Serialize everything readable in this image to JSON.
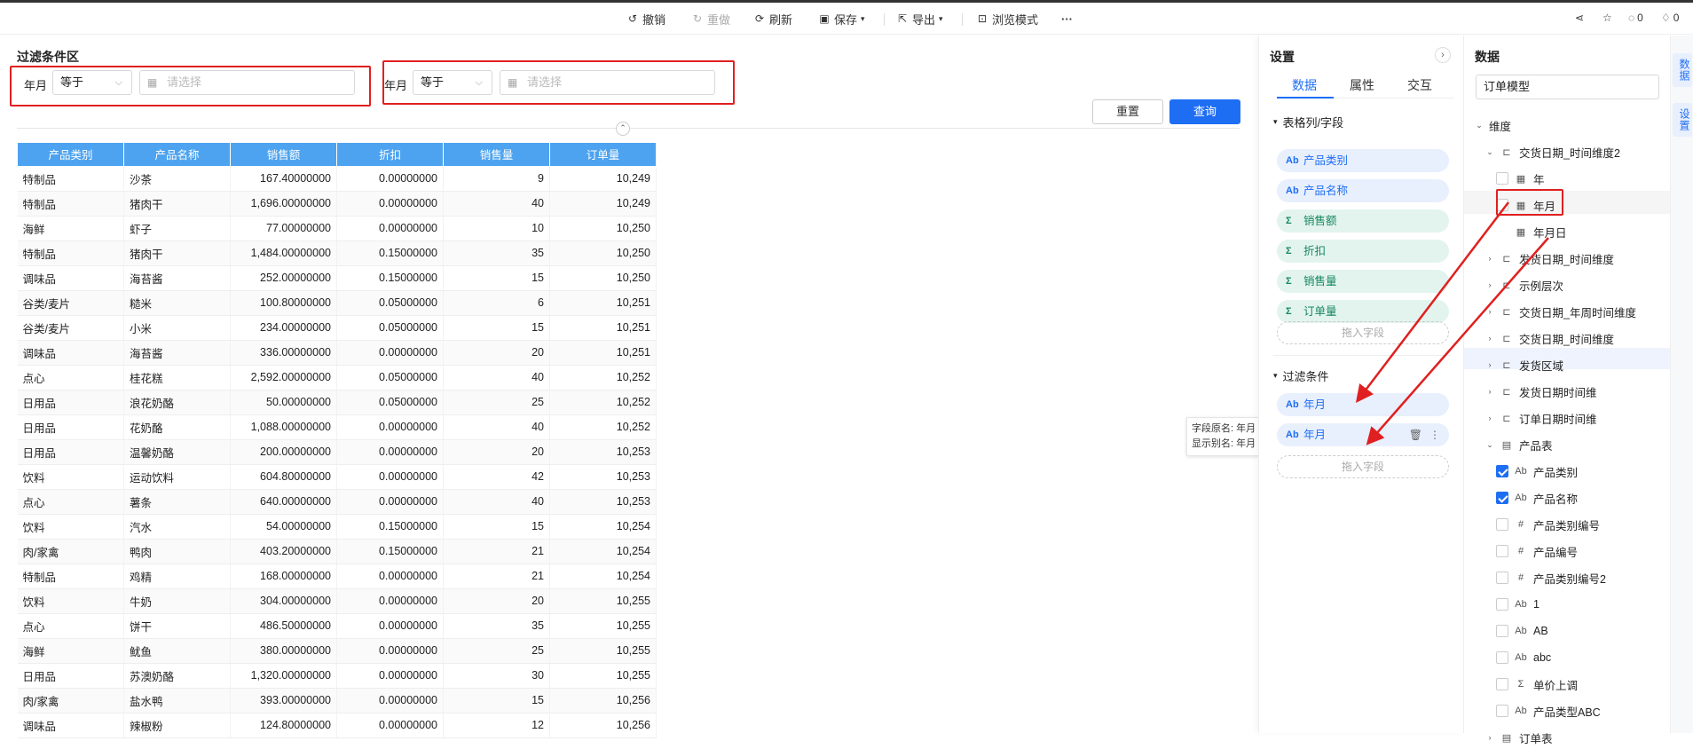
{
  "toolbar": {
    "undo": "撤销",
    "redo": "重做",
    "refresh": "刷新",
    "save": "保存",
    "export": "导出",
    "browse": "浏览模式",
    "comments_count": "0",
    "likes_count": "0"
  },
  "filter_area": {
    "title": "过滤条件区",
    "filters": [
      {
        "label": "年月",
        "operator": "等于",
        "placeholder": "请选择"
      },
      {
        "label": "年月",
        "operator": "等于",
        "placeholder": "请选择"
      }
    ],
    "reset_label": "重置",
    "query_label": "查询"
  },
  "table": {
    "columns": [
      "产品类别",
      "产品名称",
      "销售额",
      "折扣",
      "销售量",
      "订单量"
    ],
    "rows": [
      [
        "特制品",
        "沙茶",
        "167.40000000",
        "0.00000000",
        "9",
        "10,249"
      ],
      [
        "特制品",
        "猪肉干",
        "1,696.00000000",
        "0.00000000",
        "40",
        "10,249"
      ],
      [
        "海鲜",
        "虾子",
        "77.00000000",
        "0.00000000",
        "10",
        "10,250"
      ],
      [
        "特制品",
        "猪肉干",
        "1,484.00000000",
        "0.15000000",
        "35",
        "10,250"
      ],
      [
        "调味品",
        "海苔酱",
        "252.00000000",
        "0.15000000",
        "15",
        "10,250"
      ],
      [
        "谷类/麦片",
        "糙米",
        "100.80000000",
        "0.05000000",
        "6",
        "10,251"
      ],
      [
        "谷类/麦片",
        "小米",
        "234.00000000",
        "0.05000000",
        "15",
        "10,251"
      ],
      [
        "调味品",
        "海苔酱",
        "336.00000000",
        "0.00000000",
        "20",
        "10,251"
      ],
      [
        "点心",
        "桂花糕",
        "2,592.00000000",
        "0.05000000",
        "40",
        "10,252"
      ],
      [
        "日用品",
        "浪花奶酪",
        "50.00000000",
        "0.05000000",
        "25",
        "10,252"
      ],
      [
        "日用品",
        "花奶酪",
        "1,088.00000000",
        "0.00000000",
        "40",
        "10,252"
      ],
      [
        "日用品",
        "温馨奶酪",
        "200.00000000",
        "0.00000000",
        "20",
        "10,253"
      ],
      [
        "饮料",
        "运动饮料",
        "604.80000000",
        "0.00000000",
        "42",
        "10,253"
      ],
      [
        "点心",
        "薯条",
        "640.00000000",
        "0.00000000",
        "40",
        "10,253"
      ],
      [
        "饮料",
        "汽水",
        "54.00000000",
        "0.15000000",
        "15",
        "10,254"
      ],
      [
        "肉/家禽",
        "鸭肉",
        "403.20000000",
        "0.15000000",
        "21",
        "10,254"
      ],
      [
        "特制品",
        "鸡精",
        "168.00000000",
        "0.00000000",
        "21",
        "10,254"
      ],
      [
        "饮料",
        "牛奶",
        "304.00000000",
        "0.00000000",
        "20",
        "10,255"
      ],
      [
        "点心",
        "饼干",
        "486.50000000",
        "0.00000000",
        "35",
        "10,255"
      ],
      [
        "海鲜",
        "鱿鱼",
        "380.00000000",
        "0.00000000",
        "25",
        "10,255"
      ],
      [
        "日用品",
        "苏澳奶酪",
        "1,320.00000000",
        "0.00000000",
        "30",
        "10,255"
      ],
      [
        "肉/家禽",
        "盐水鸭",
        "393.00000000",
        "0.00000000",
        "15",
        "10,256"
      ],
      [
        "调味品",
        "辣椒粉",
        "124.80000000",
        "0.00000000",
        "12",
        "10,256"
      ]
    ]
  },
  "tooltip": {
    "line1": "字段原名: 年月",
    "line2": "显示别名: 年月"
  },
  "settings": {
    "title": "设置",
    "tabs": [
      "数据",
      "属性",
      "交互"
    ],
    "columns_section": "表格列/字段",
    "columns": [
      {
        "icon": "Ab",
        "label": "产品类别",
        "kind": "dim"
      },
      {
        "icon": "Ab",
        "label": "产品名称",
        "kind": "dim"
      },
      {
        "icon": "Σ",
        "label": "销售额",
        "kind": "meas"
      },
      {
        "icon": "Σ",
        "label": "折扣",
        "kind": "meas"
      },
      {
        "icon": "Σ",
        "label": "销售量",
        "kind": "meas"
      },
      {
        "icon": "Σ",
        "label": "订单量",
        "kind": "meas"
      }
    ],
    "drop_label": "拖入字段",
    "filter_section": "过滤条件",
    "filters": [
      {
        "icon": "Ab",
        "label": "年月"
      },
      {
        "icon": "Ab",
        "label": "年月"
      }
    ]
  },
  "data_panel": {
    "title": "数据",
    "model": "订单模型",
    "tree": [
      {
        "label": "维度",
        "level": 0,
        "arrow": "open"
      },
      {
        "label": "交货日期_时间维度2",
        "level": 1,
        "arrow": "open",
        "icon": "hier"
      },
      {
        "label": "年",
        "level": 2,
        "check": "off",
        "icon": "date"
      },
      {
        "label": "年月",
        "level": 2,
        "check": "off",
        "icon": "date"
      },
      {
        "label": "年月日",
        "level": 2,
        "check": "none",
        "icon": "date"
      },
      {
        "label": "发货日期_时间维度",
        "level": 1,
        "arrow": "closed",
        "icon": "hier"
      },
      {
        "label": "示例层次",
        "level": 1,
        "arrow": "closed",
        "icon": "hier"
      },
      {
        "label": "交货日期_年周时间维度",
        "level": 1,
        "arrow": "closed",
        "icon": "hier"
      },
      {
        "label": "交货日期_时间维度",
        "level": 1,
        "arrow": "closed",
        "icon": "hier"
      },
      {
        "label": "发货区域",
        "level": 1,
        "arrow": "closed",
        "icon": "hier"
      },
      {
        "label": "发货日期时间维",
        "level": 1,
        "arrow": "closed",
        "icon": "hier"
      },
      {
        "label": "订单日期时间维",
        "level": 1,
        "arrow": "closed",
        "icon": "hier"
      },
      {
        "label": "产品表",
        "level": 1,
        "arrow": "open",
        "icon": "table"
      },
      {
        "label": "产品类别",
        "level": 2,
        "check": "on",
        "icon": "Ab"
      },
      {
        "label": "产品名称",
        "level": 2,
        "check": "on",
        "icon": "Ab"
      },
      {
        "label": "产品类别编号",
        "level": 2,
        "check": "off",
        "icon": "#"
      },
      {
        "label": "产品编号",
        "level": 2,
        "check": "off",
        "icon": "#"
      },
      {
        "label": "产品类别编号2",
        "level": 2,
        "check": "off",
        "icon": "#"
      },
      {
        "label": "1",
        "level": 2,
        "check": "off",
        "icon": "Ab"
      },
      {
        "label": "AB",
        "level": 2,
        "check": "off",
        "icon": "Ab"
      },
      {
        "label": "abc",
        "level": 2,
        "check": "off",
        "icon": "Ab"
      },
      {
        "label": "单价上调",
        "level": 2,
        "check": "off",
        "icon": "Σ"
      },
      {
        "label": "产品类型ABC",
        "level": 2,
        "check": "off",
        "icon": "Ab"
      },
      {
        "label": "订单表",
        "level": 1,
        "arrow": "closed",
        "icon": "table"
      }
    ]
  },
  "side_tabs": [
    "数据",
    "设置"
  ]
}
